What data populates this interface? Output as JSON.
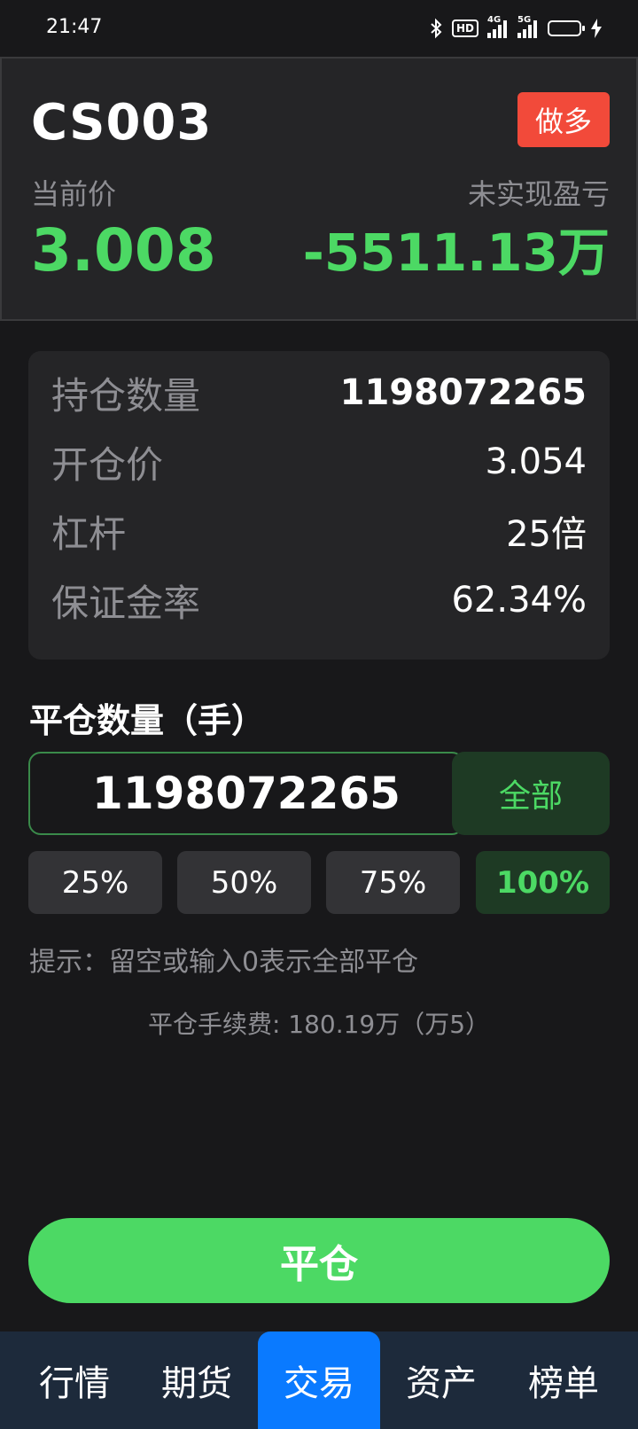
{
  "status_bar": {
    "time": "21:47",
    "icons": [
      "bluetooth-icon",
      "hd-icon",
      "4g-signal-icon",
      "5g-signal-icon",
      "battery-icon",
      "charging-icon"
    ],
    "hd_label": "HD",
    "sig1_label": "4G",
    "sig2_label": "5G",
    "battery_color": "#e2a722"
  },
  "position": {
    "symbol": "CS003",
    "direction": "做多",
    "current_price_label": "当前价",
    "current_price": "3.008",
    "pnl_label": "未实现盈亏",
    "pnl_value": "-5511.13万"
  },
  "details": {
    "rows": [
      {
        "label": "持仓数量",
        "value": "1198072265"
      },
      {
        "label": "开仓价",
        "value": "3.054"
      },
      {
        "label": "杠杆",
        "value": "25倍"
      },
      {
        "label": "保证金率",
        "value": "62.34%"
      }
    ]
  },
  "close_form": {
    "title": "平仓数量（手）",
    "quantity_value": "1198072265",
    "all_label": "全部",
    "percent_buttons": [
      "25%",
      "50%",
      "75%",
      "100%"
    ],
    "selected_percent": "100%",
    "hint": "提示：留空或输入0表示全部平仓",
    "fee": "平仓手续费: 180.19万（万5）",
    "submit_label": "平仓"
  },
  "tabbar": {
    "tabs": [
      "行情",
      "期货",
      "交易",
      "资产",
      "榜单"
    ],
    "active": "交易"
  },
  "colors": {
    "background": "#18181a",
    "card": "#252527",
    "accent_green": "#4cd964",
    "long_badge": "#f24a3a",
    "active_tab": "#0a7aff"
  }
}
